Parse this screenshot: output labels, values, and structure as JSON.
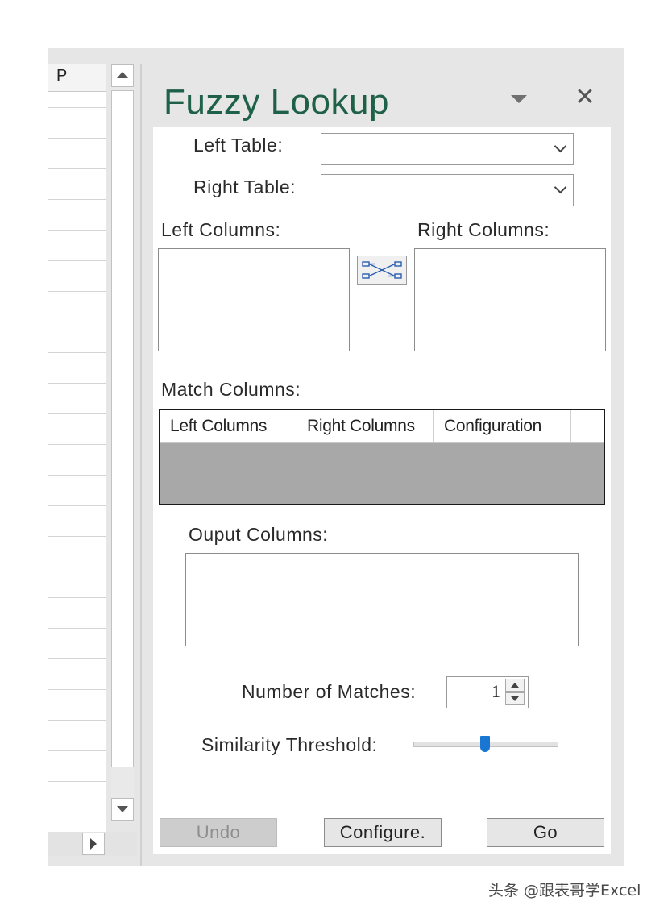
{
  "spreadsheet": {
    "column_header": "P"
  },
  "pane": {
    "title": "Fuzzy Lookup",
    "left_table_label": "Left Table:",
    "left_table_value": "",
    "right_table_label": "Right Table:",
    "right_table_value": "",
    "left_columns_label": "Left Columns:",
    "right_columns_label": "Right Columns:",
    "match_columns_label": "Match Columns:",
    "match_grid": {
      "columns": [
        "Left Columns",
        "Right Columns",
        "Configuration"
      ]
    },
    "output_columns_label": "Ouput Columns:",
    "number_of_matches_label": "Number of Matches:",
    "number_of_matches_value": "1",
    "similarity_threshold_label": "Similarity Threshold:",
    "similarity_threshold_level": 0.5,
    "buttons": {
      "undo": "Undo",
      "configure": "Configure.",
      "go": "Go"
    }
  },
  "watermark": "头条 @跟表哥学Excel",
  "colors": {
    "title": "#1e6048",
    "slider_thumb": "#1976d2",
    "grid_body": "#a8a8a8"
  }
}
